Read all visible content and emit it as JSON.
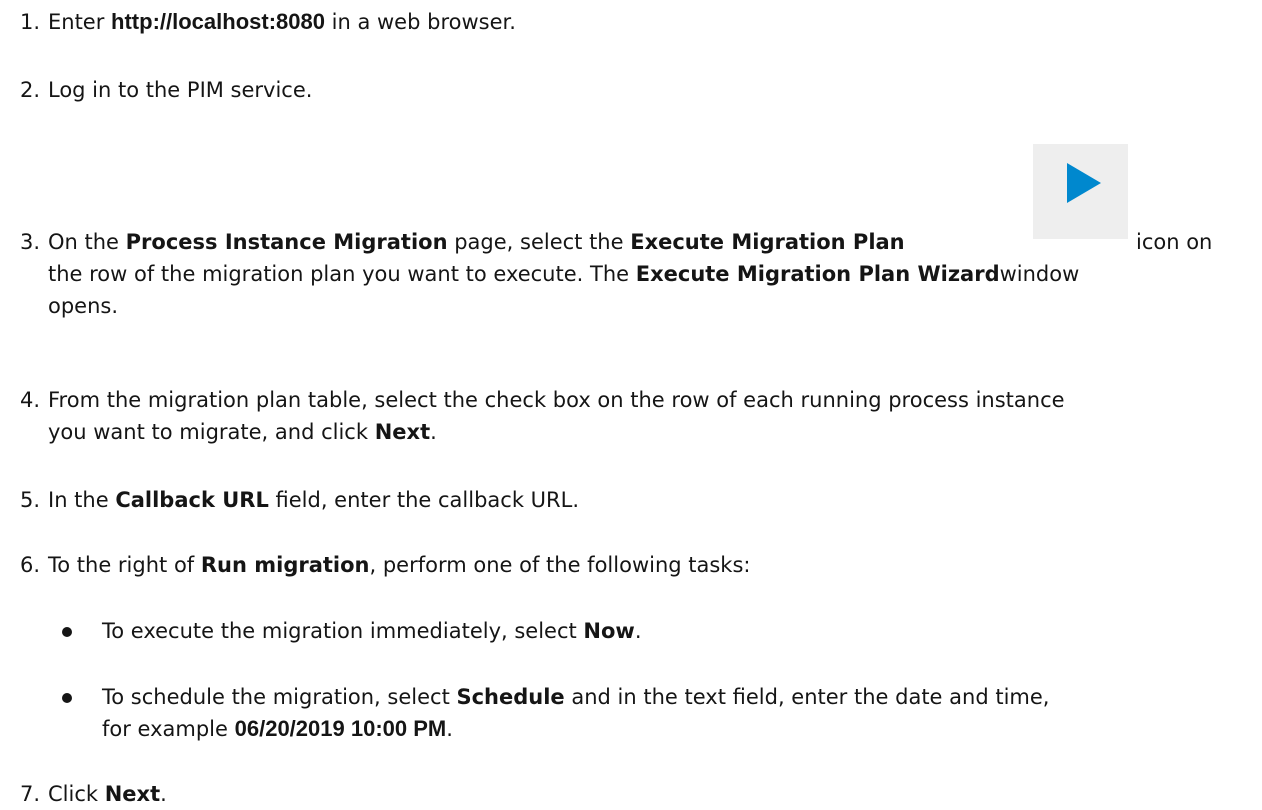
{
  "steps": [
    {
      "num": "1.",
      "a": "Enter ",
      "b": "http://localhost:8080",
      "c": " in a web browser."
    },
    {
      "num": "2.",
      "a": "Log in to the PIM service."
    },
    {
      "num": "3.",
      "a": "On the ",
      "b": "Process Instance Migration",
      "c": " page, select the ",
      "d": "Execute Migration Plan",
      "e": "icon on",
      "f": "the row of the migration plan you want to execute. The ",
      "g": "Execute Migration Plan Wizard",
      "h": "window",
      "i": "opens."
    },
    {
      "num": "4.",
      "a": "From the migration plan table, select the check box on the row of each running process instance",
      "b": "you want to migrate, and click ",
      "c": "Next",
      "d": "."
    },
    {
      "num": "5.",
      "a": "In the ",
      "b": "Callback URL",
      "c": " field, enter the callback URL."
    },
    {
      "num": "6.",
      "a": "To the right of ",
      "b": "Run migration",
      "c": ", perform one of the following tasks:"
    },
    {
      "num": "7.",
      "a": "Click ",
      "b": "Next",
      "c": "."
    }
  ],
  "bullets": [
    {
      "a": "To execute the migration immediately, select ",
      "b": "Now",
      "c": "."
    },
    {
      "a": "To schedule the migration, select ",
      "b": "Schedule",
      "c": " and in the text field, enter the date and time,",
      "d": "for example ",
      "e": "06/20/2019 10:00 PM",
      "f": "."
    }
  ],
  "icon": {
    "name": "play-icon",
    "color": "#0088ce"
  }
}
